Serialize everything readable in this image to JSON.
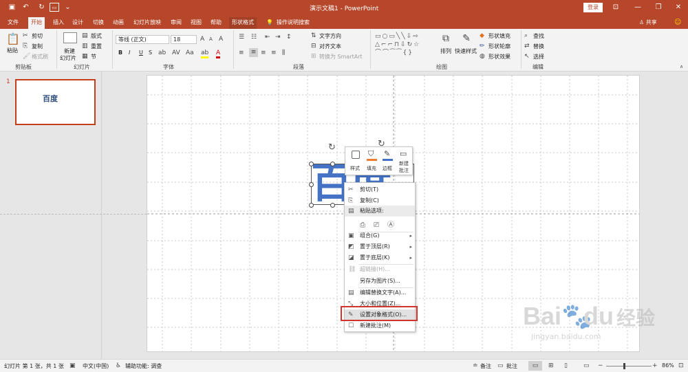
{
  "titlebar": {
    "title": "演示文稿1  -  PowerPoint",
    "login": "登录"
  },
  "tabs": [
    {
      "label": "文件",
      "active": false
    },
    {
      "label": "开始",
      "active": true
    },
    {
      "label": "插入",
      "active": false
    },
    {
      "label": "设计",
      "active": false
    },
    {
      "label": "切换",
      "active": false
    },
    {
      "label": "动画",
      "active": false
    },
    {
      "label": "幻灯片放映",
      "active": false
    },
    {
      "label": "审阅",
      "active": false
    },
    {
      "label": "视图",
      "active": false
    },
    {
      "label": "帮助",
      "active": false
    },
    {
      "label": "形状格式",
      "active": false
    },
    {
      "label": "操作说明搜索",
      "active": false
    }
  ],
  "share": "共享",
  "ribbon": {
    "clipboard": {
      "paste": "粘贴",
      "cut": "剪切",
      "copy": "复制",
      "format_painter": "格式刷",
      "group": "剪贴板"
    },
    "slides": {
      "new_slide": "新建",
      "new_slide2": "幻灯片",
      "layout": "版式",
      "reset": "重置",
      "section": "节",
      "group": "幻灯片"
    },
    "font": {
      "name": "等线 (正文)",
      "size": "18",
      "b": "B",
      "i": "I",
      "u": "U",
      "s": "S",
      "group": "字体"
    },
    "paragraph": {
      "text_dir": "文字方向",
      "align_text": "对齐文本",
      "smartart": "转换为 SmartArt",
      "group": "段落"
    },
    "drawing": {
      "arrange": "排列",
      "quick_styles": "快速样式",
      "fill": "形状填充",
      "outline": "形状轮廓",
      "effects": "形状效果",
      "group": "绘图"
    },
    "editing": {
      "find": "查找",
      "replace": "替换",
      "select": "选择",
      "group": "编辑"
    }
  },
  "thumbnail": {
    "number": "1",
    "text": "百度"
  },
  "slide": {
    "text": "百度"
  },
  "minitoolbar": {
    "style": "样式",
    "fill": "填充",
    "border": "边框",
    "new_comment": "新建",
    "new_comment2": "批注"
  },
  "context_menu": [
    {
      "label": "剪切(T)",
      "icon": "✂",
      "disabled": false,
      "arrow": false
    },
    {
      "label": "复制(C)",
      "icon": "⎘",
      "disabled": false,
      "arrow": false
    },
    {
      "label": "粘贴选项:",
      "icon": "📋",
      "disabled": false,
      "arrow": false,
      "header": true
    },
    {
      "label": "",
      "icon": "",
      "disabled": false,
      "arrow": false,
      "pasterow": true
    },
    {
      "label": "组合(G)",
      "icon": "▣",
      "disabled": false,
      "arrow": true
    },
    {
      "label": "置于顶层(R)",
      "icon": "◩",
      "disabled": false,
      "arrow": true
    },
    {
      "label": "置于底层(K)",
      "icon": "◪",
      "disabled": false,
      "arrow": true
    },
    {
      "label": "超链接(H)...",
      "icon": "🔗",
      "disabled": true,
      "arrow": false
    },
    {
      "label": "另存为图片(S)...",
      "icon": "",
      "disabled": false,
      "arrow": false
    },
    {
      "label": "编辑替换文字(A)...",
      "icon": "▤",
      "disabled": false,
      "arrow": false
    },
    {
      "label": "大小和位置(Z)...",
      "icon": "⤡",
      "disabled": false,
      "arrow": false
    },
    {
      "label": "设置对象格式(O)...",
      "icon": "✎",
      "disabled": false,
      "arrow": false,
      "highlight": true
    },
    {
      "label": "新建批注(M)",
      "icon": "☐",
      "disabled": false,
      "arrow": false
    }
  ],
  "status": {
    "slide_info": "幻灯片 第 1 张，共 1 张",
    "language": "中文(中国)",
    "accessibility": "辅助功能: 调查",
    "notes": "备注",
    "comments": "批注",
    "zoom": "86%"
  },
  "watermark": {
    "text": "Bai",
    "text2": "du",
    "text3": "经验",
    "url": "jingyan.baidu.com"
  },
  "colors": {
    "accent": "#b7472a",
    "highlight": "#c43e1c",
    "textblue": "#4472c4"
  }
}
